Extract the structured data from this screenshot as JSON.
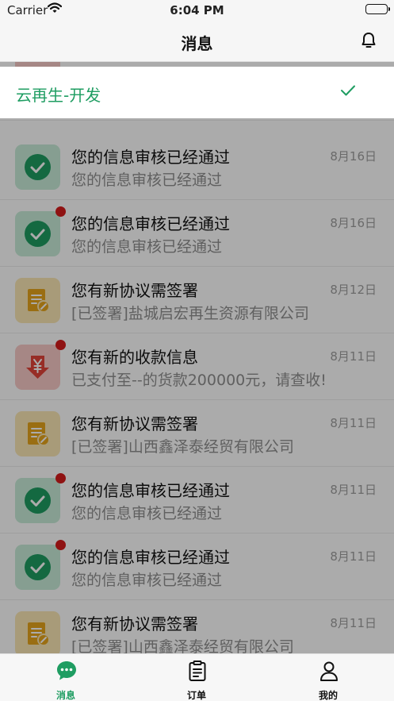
{
  "status_bar": {
    "carrier": "Carrier",
    "time": "6:04 PM"
  },
  "nav": {
    "title": "消息",
    "bell_icon": "bell-icon"
  },
  "dropdown": {
    "option_label": "云再生-开发",
    "selected": true,
    "accent_color": "#1f9d62"
  },
  "messages": [
    {
      "title": "您的信息审核已经通过",
      "subtitle": "您的信息审核已经通过",
      "date": "8月16日",
      "icon": "check-circle-icon",
      "unread": false
    },
    {
      "title": "您的信息审核已经通过",
      "subtitle": "您的信息审核已经通过",
      "date": "8月16日",
      "icon": "check-circle-icon",
      "unread": true
    },
    {
      "title": "您有新协议需签署",
      "subtitle": "[已签署]盐城启宏再生资源有限公司",
      "date": "8月12日",
      "icon": "document-sign-icon",
      "unread": false
    },
    {
      "title": "您有新的收款信息",
      "subtitle": "已支付至--的货款200000元，请查收!",
      "date": "8月11日",
      "icon": "yuan-down-arrow-icon",
      "unread": true
    },
    {
      "title": "您有新协议需签署",
      "subtitle": "[已签署]山西鑫泽泰经贸有限公司",
      "date": "8月11日",
      "icon": "document-sign-icon",
      "unread": false
    },
    {
      "title": "您的信息审核已经通过",
      "subtitle": "您的信息审核已经通过",
      "date": "8月11日",
      "icon": "check-circle-icon",
      "unread": true
    },
    {
      "title": "您的信息审核已经通过",
      "subtitle": "您的信息审核已经通过",
      "date": "8月11日",
      "icon": "check-circle-icon",
      "unread": true
    },
    {
      "title": "您有新协议需签署",
      "subtitle": "[已签署]山西鑫泽泰经贸有限公司",
      "date": "8月11日",
      "icon": "document-sign-icon",
      "unread": false
    }
  ],
  "tab_bar": {
    "tabs": [
      {
        "label": "消息",
        "icon": "chat-bubble-icon",
        "active": true
      },
      {
        "label": "订单",
        "icon": "clipboard-icon",
        "active": false
      },
      {
        "label": "我的",
        "icon": "user-icon",
        "active": false
      }
    ]
  }
}
